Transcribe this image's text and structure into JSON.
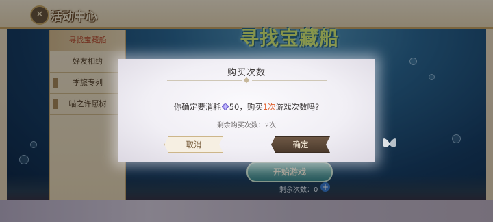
{
  "header": {
    "title": "活动中心"
  },
  "banner": {
    "title": "寻找宝藏船"
  },
  "sidebar": {
    "items": [
      {
        "label": "寻找宝藏船",
        "active": true
      },
      {
        "label": "好友相约",
        "active": false
      },
      {
        "label": "季旅专列",
        "active": false
      },
      {
        "label": "喵之许愿树",
        "active": false
      }
    ]
  },
  "background": {
    "start_label": "开始游戏",
    "remaining_label": "剩余次数：0"
  },
  "dialog": {
    "title": "购买次数",
    "confirm_prefix": "你确定要消耗",
    "gem_cost": "50",
    "confirm_mid": "，购买",
    "buy_count": "1次",
    "confirm_suffix": "游戏次数吗?",
    "remaining_text": "剩余购买次数：2次",
    "cancel_label": "取消",
    "ok_label": "确定"
  },
  "colors": {
    "highlight": "#e0602e",
    "ok_button": "#5a4636",
    "dialog_bg": "#f4f2f7"
  },
  "icons": {
    "gem": "gem-icon",
    "plus": "plus-icon",
    "emblem": "compass-emblem-icon",
    "butterfly": "butterfly-icon"
  }
}
